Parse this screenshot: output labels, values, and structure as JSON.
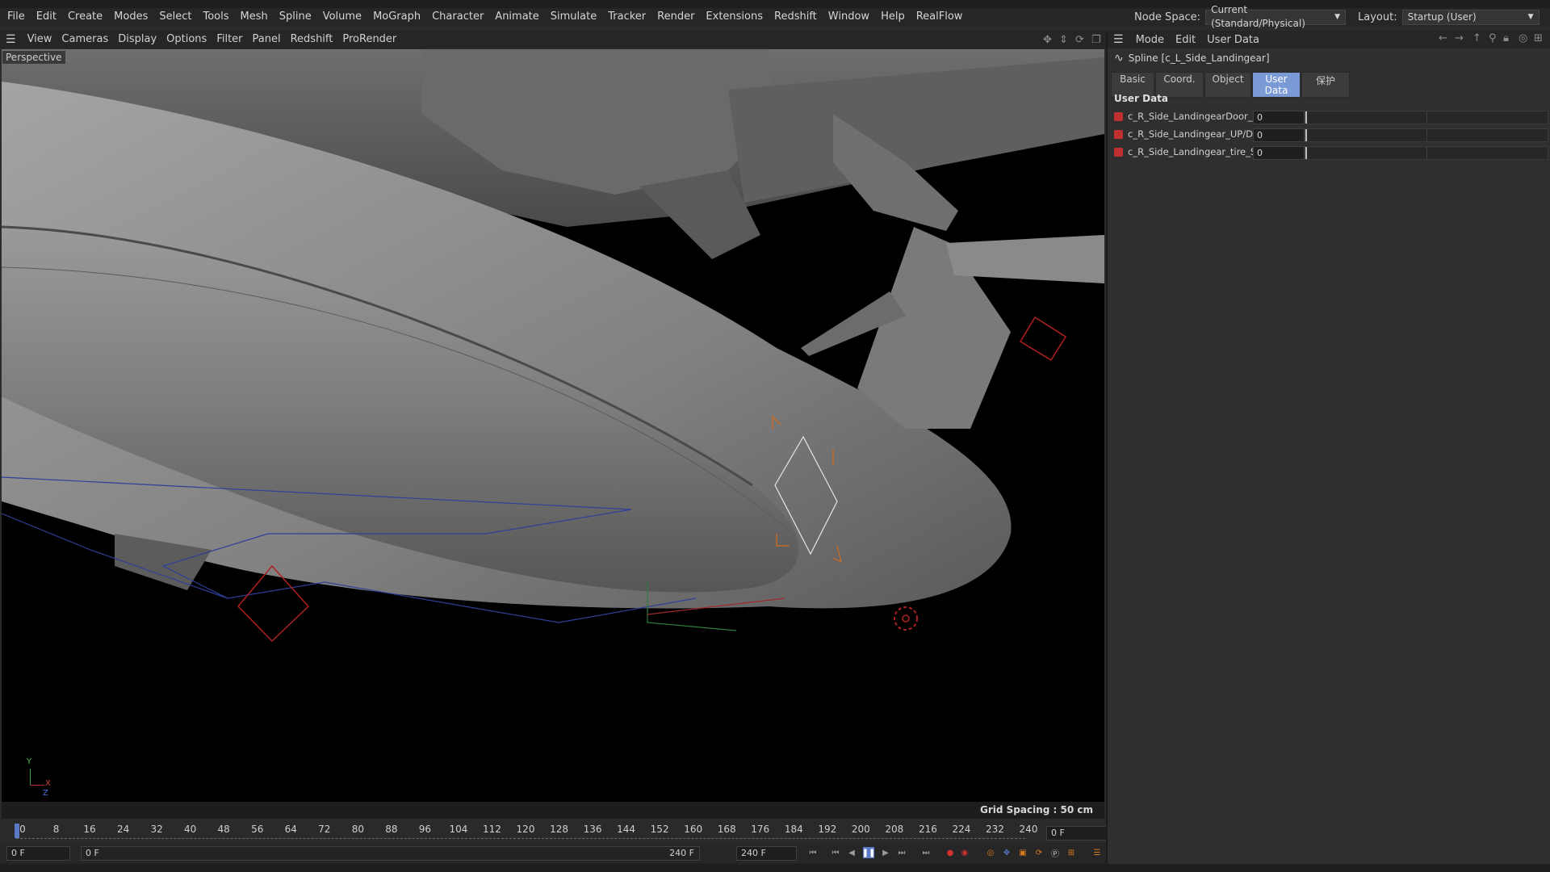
{
  "menu": {
    "items": [
      "File",
      "Edit",
      "Create",
      "Modes",
      "Select",
      "Tools",
      "Mesh",
      "Spline",
      "Volume",
      "MoGraph",
      "Character",
      "Animate",
      "Simulate",
      "Tracker",
      "Render",
      "Extensions",
      "Redshift",
      "Window",
      "Help",
      "RealFlow"
    ],
    "node_space_label": "Node Space:",
    "node_space_value": "Current (Standard/Physical)",
    "layout_label": "Layout:",
    "layout_value": "Startup (User)"
  },
  "viewport": {
    "toolbar": [
      "View",
      "Cameras",
      "Display",
      "Options",
      "Filter",
      "Panel",
      "Redshift",
      "ProRender"
    ],
    "camera_label": "Perspective",
    "grid_spacing": "Grid Spacing : 50 cm",
    "axis": {
      "x": "X",
      "y": "Y",
      "z": "Z"
    }
  },
  "timeline": {
    "ticks": [
      "0",
      "8",
      "16",
      "24",
      "32",
      "40",
      "48",
      "56",
      "64",
      "72",
      "80",
      "88",
      "96",
      "104",
      "112",
      "120",
      "128",
      "136",
      "144",
      "152",
      "160",
      "168",
      "176",
      "184",
      "192",
      "200",
      "208",
      "216",
      "224",
      "232",
      "240"
    ],
    "current_frame_field": "0 F",
    "start_field": "0 F",
    "min_field": "0 F",
    "max_label": "240 F",
    "end_field": "240 F"
  },
  "attributes": {
    "toolbar": [
      "Mode",
      "Edit",
      "User Data"
    ],
    "object_title": "Spline [c_L_Side_Landingear]",
    "tabs": [
      {
        "label": "Basic",
        "active": false
      },
      {
        "label": "Coord.",
        "active": false
      },
      {
        "label": "Object",
        "active": false
      },
      {
        "label": "User Data",
        "active": true
      },
      {
        "label": "保护",
        "active": false
      }
    ],
    "section_title": "User Data",
    "rows": [
      {
        "label": "c_R_Side_LandingearDoor_ON/OFF",
        "value": "0"
      },
      {
        "label": "c_R_Side_Landingear_UP/D . . . . . .",
        "value": "0"
      },
      {
        "label": "c_R_Side_Landingear_tire_SPEED . .",
        "value": "0"
      }
    ]
  }
}
